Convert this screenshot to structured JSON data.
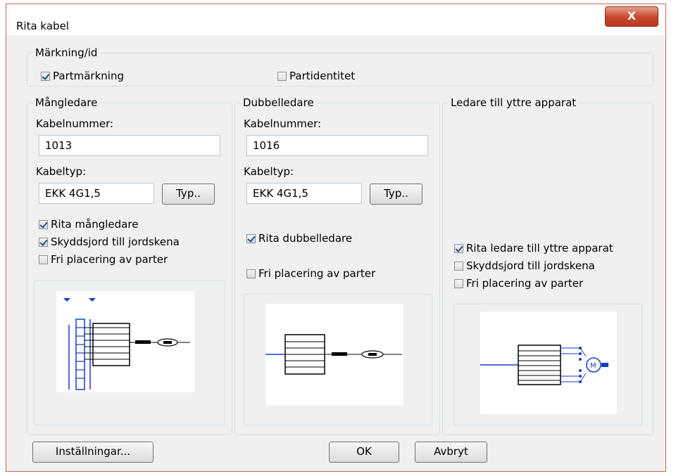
{
  "window": {
    "title": "Rita kabel",
    "close_label": "X"
  },
  "marking": {
    "legend": "Märkning/id",
    "partmarking": {
      "label": "Partmärkning",
      "checked": true
    },
    "partidentity": {
      "label": "Partidentitet",
      "checked": false
    }
  },
  "multi": {
    "legend": "Mångledare",
    "cable_number_label": "Kabelnummer:",
    "cable_number_value": "1013",
    "cable_type_label": "Kabeltyp:",
    "cable_type_value": "EKK 4G1,5",
    "type_button": "Typ..",
    "check_draw": {
      "label": "Rita mångledare",
      "checked": true
    },
    "check_earth": {
      "label": "Skyddsjord till jordskena",
      "checked": true
    },
    "check_free": {
      "label": "Fri placering av parter",
      "checked": false
    }
  },
  "double": {
    "legend": "Dubbelledare",
    "cable_number_label": "Kabelnummer:",
    "cable_number_value": "1016",
    "cable_type_label": "Kabeltyp:",
    "cable_type_value": "EKK 4G1,5",
    "type_button": "Typ..",
    "check_draw": {
      "label": "Rita dubbelledare",
      "checked": true
    },
    "check_free": {
      "label": "Fri placering av parter",
      "checked": false
    }
  },
  "external": {
    "legend": "Ledare till yttre apparat",
    "check_draw": {
      "label": "Rita ledare till yttre apparat",
      "checked": true
    },
    "check_earth": {
      "label": "Skyddsjord till jordskena",
      "checked": false
    },
    "check_free": {
      "label": "Fri placering av parter",
      "checked": false
    }
  },
  "footer": {
    "settings_button": "Inställningar...",
    "ok_button": "OK",
    "cancel_button": "Avbryt"
  }
}
